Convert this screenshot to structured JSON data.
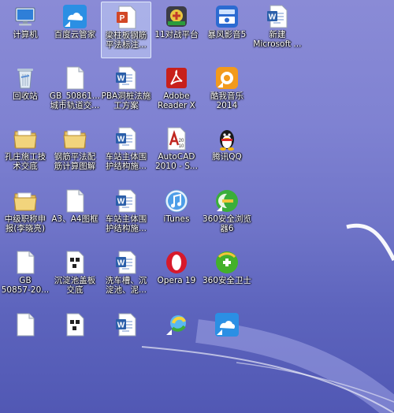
{
  "desktop": {
    "icons": [
      {
        "label": "计算机",
        "icon": "computer-icon"
      },
      {
        "label": "百度云管家",
        "icon": "baidu-cloud-icon"
      },
      {
        "label": "梁柱板钢筋\n平法标注...",
        "icon": "ppt-file-icon"
      },
      {
        "label": "11对战平台",
        "icon": "game-platform-icon"
      },
      {
        "label": "暴风影音5",
        "icon": "storm-player-icon"
      },
      {
        "label": "新建\nMicrosoft ...",
        "icon": "word-doc-icon"
      },
      {
        "label": "回收站",
        "icon": "recycle-bin-icon"
      },
      {
        "label": "GB_50861...\n城市轨道交...",
        "icon": "document-file-icon"
      },
      {
        "label": "PBA洞桩法施\n工方案",
        "icon": "word-doc-icon"
      },
      {
        "label": "Adobe\nReader X",
        "icon": "adobe-reader-icon"
      },
      {
        "label": "酷我音乐\n2014",
        "icon": "kuwo-music-icon"
      },
      {
        "label": "孔庄施工技\n术交底",
        "icon": "folder-icon"
      },
      {
        "label": "钢筋平法配\n筋计算图解",
        "icon": "folder-icon"
      },
      {
        "label": "车站主体围\n护结构施...",
        "icon": "word-doc-icon"
      },
      {
        "label": "AutoCAD\n2010 - S...",
        "icon": "autocad-icon"
      },
      {
        "label": "腾讯QQ",
        "icon": "qq-penguin-icon"
      },
      {
        "label": "中级职称申\n报(李晓亮)",
        "icon": "folder-icon"
      },
      {
        "label": "A3、A4图框",
        "icon": "document-file-icon"
      },
      {
        "label": "车站主体围\n护结构施...",
        "icon": "word-doc-icon"
      },
      {
        "label": "iTunes",
        "icon": "itunes-icon"
      },
      {
        "label": "360安全浏览\n器6",
        "icon": "360-browser-icon"
      },
      {
        "label": "GB\n50857-20...",
        "icon": "document-file-icon"
      },
      {
        "label": "沉淀池盖板\n交底",
        "icon": "drawing-file-icon"
      },
      {
        "label": "洗车槽、沉\n淀池、泥...",
        "icon": "word-doc-icon"
      },
      {
        "label": "Opera 19",
        "icon": "opera-icon"
      },
      {
        "label": "360安全卫士",
        "icon": "360-security-icon"
      },
      {
        "label": "",
        "icon": "document-file-icon"
      },
      {
        "label": "",
        "icon": "drawing-file-icon"
      },
      {
        "label": "",
        "icon": "word-doc-icon"
      },
      {
        "label": "",
        "icon": "shortcut-app-icon"
      },
      {
        "label": "",
        "icon": "baidu-cloud-icon"
      }
    ]
  },
  "colors": {
    "background": "#7f82d2",
    "selection": "#d2e1ff"
  }
}
